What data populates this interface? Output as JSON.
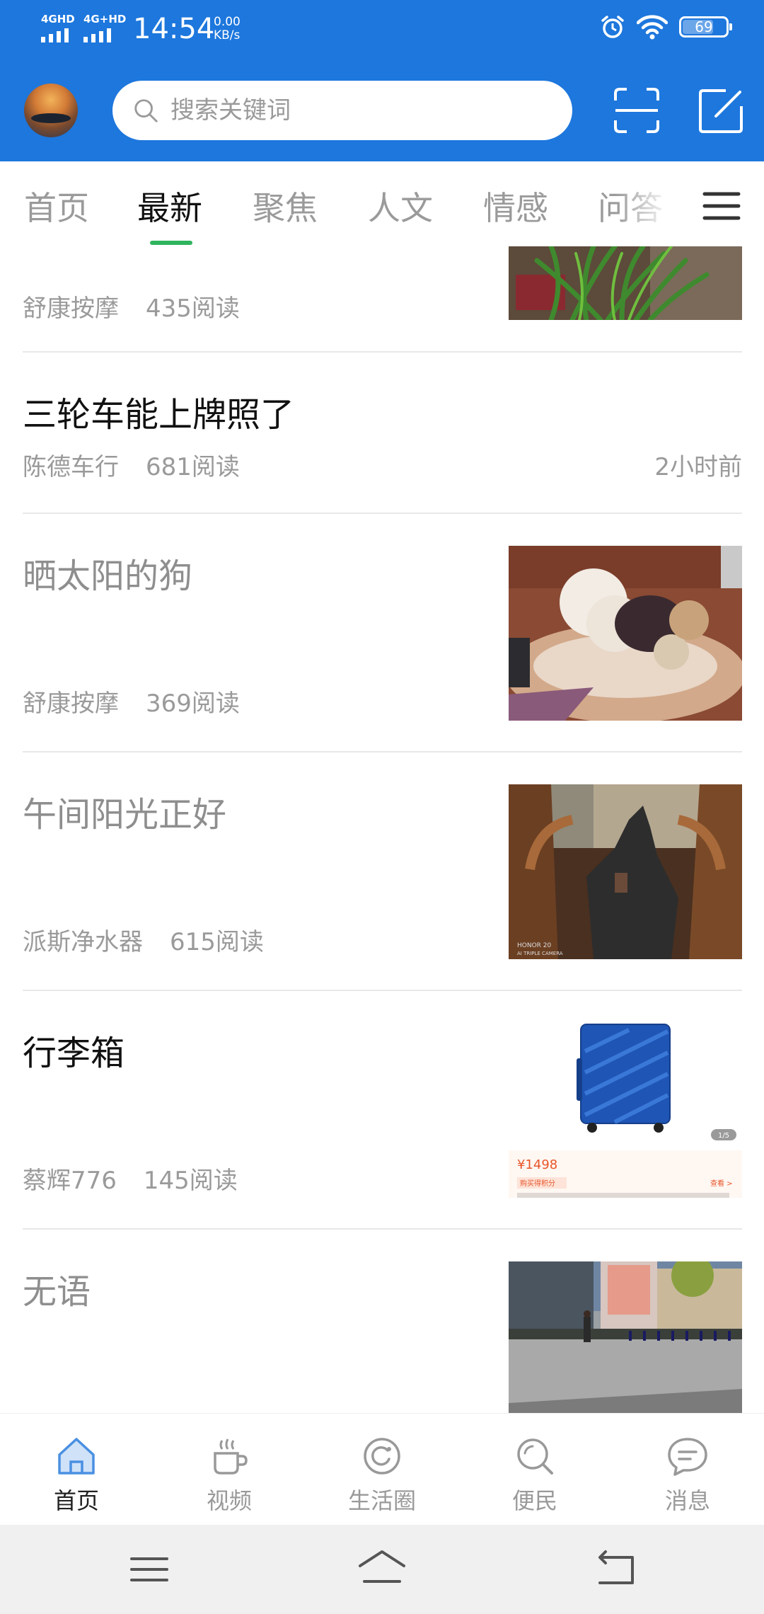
{
  "status_bar": {
    "network1": "4GHD",
    "network2": "4G+HD",
    "time": "14:54",
    "speed_value": "0.00",
    "speed_unit": "KB/s",
    "battery": "69",
    "battery_level": 0.69,
    "icons": [
      "alarm-icon",
      "wifi-icon",
      "battery-icon"
    ]
  },
  "header": {
    "search_placeholder": "搜索关键词",
    "icons": [
      "avatar",
      "scan-icon",
      "edit-icon"
    ]
  },
  "tabs": {
    "items": [
      "首页",
      "最新",
      "聚焦",
      "人文",
      "情感",
      "问答"
    ],
    "active": "最新"
  },
  "feed": [
    {
      "title": "",
      "source": "舒康按摩",
      "reads": "435阅读",
      "time": "",
      "thumb": "plant"
    },
    {
      "title": "三轮车能上牌照了",
      "source": "陈德车行",
      "reads": "681阅读",
      "time": "2小时前",
      "thumb": ""
    },
    {
      "title": "晒太阳的狗",
      "source": "舒康按摩",
      "reads": "369阅读",
      "time": "",
      "thumb": "dog"
    },
    {
      "title": "午间阳光正好",
      "source": "派斯净水器",
      "reads": "615阅读",
      "time": "",
      "thumb": "legs"
    },
    {
      "title": "行李箱",
      "source": "蔡辉776",
      "reads": "145阅读",
      "time": "",
      "thumb": "suitcase"
    },
    {
      "title": "无语",
      "source": "",
      "reads": "",
      "time": "",
      "thumb": "street"
    }
  ],
  "suitcase_thumb": {
    "price": "¥1498",
    "counter": "1/5",
    "points": "购买得积分",
    "view": "查看 >"
  },
  "thumb_watermark": "HONOR 20\nAI TRIPLE CAMERA",
  "bottom_nav": [
    {
      "label": "首页",
      "icon": "home-icon",
      "active": true
    },
    {
      "label": "视频",
      "icon": "coffee-cup-icon",
      "active": false
    },
    {
      "label": "生活圈",
      "icon": "circle-refresh-icon",
      "active": false
    },
    {
      "label": "便民",
      "icon": "search-icon",
      "active": false
    },
    {
      "label": "消息",
      "icon": "chat-bubble-icon",
      "active": false
    }
  ],
  "colors": {
    "header_blue": "#1d77dd",
    "tab_indicator": "#2fb45e",
    "home_active": "#4a90e2"
  }
}
